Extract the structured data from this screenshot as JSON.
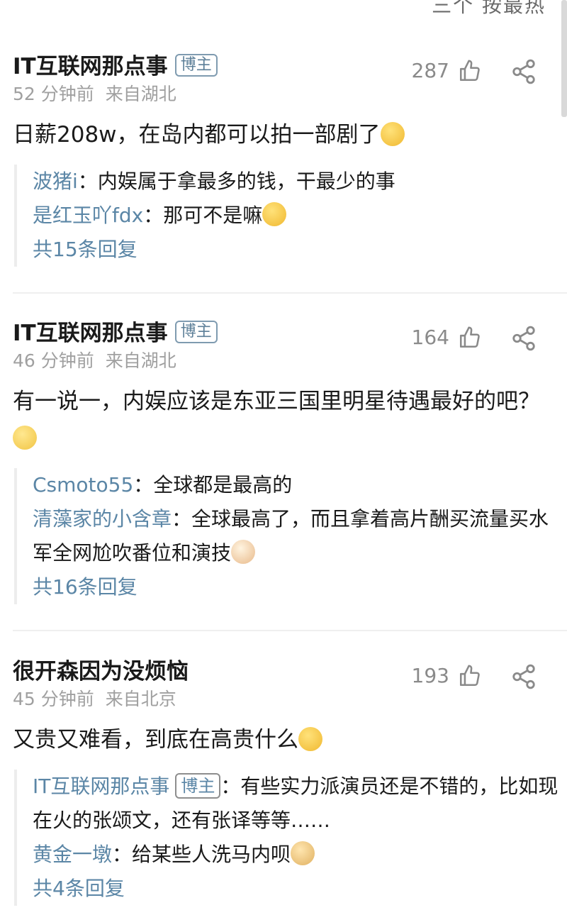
{
  "top_tabs": "三个 按最热",
  "comments": [
    {
      "username": "IT互联网那点事",
      "badge": "博主",
      "time": "52 分钟前",
      "location": "来自湖北",
      "likes": "287",
      "text": "日薪208w，在岛内都可以拍一部剧了",
      "emoji": "cry-laugh",
      "replies": [
        {
          "name": "波猪i",
          "text": "：内娱属于拿最多的钱，干最少的事"
        },
        {
          "name": "是红玉吖fdx",
          "text": "：那可不是嘛",
          "emoji": "laugh"
        }
      ],
      "more": "共15条回复"
    },
    {
      "username": "IT互联网那点事",
      "badge": "博主",
      "time": "46 分钟前",
      "location": "来自湖北",
      "likes": "164",
      "text": "有一说一，内娱应该是东亚三国里明星待遇最好的吧？",
      "emoji": "thinking",
      "replies": [
        {
          "name": "Csmoto55",
          "text": "：全球都是最高的"
        },
        {
          "name": "清藻家的小含章",
          "text": "：全球最高了，而且拿着高片酬买流量买水军全网尬吹番位和演技",
          "emoji": "cat"
        }
      ],
      "more": "共16条回复"
    },
    {
      "username": "很开森因为没烦恼",
      "time": "45 分钟前",
      "location": "来自北京",
      "likes": "193",
      "text": "又贵又难看，到底在高贵什么",
      "emoji": "shush",
      "replies": [
        {
          "name": "IT互联网那点事",
          "badge": "博主",
          "text": "：有些实力派演员还是不错的，比如现在火的张颂文，还有张译等等……"
        },
        {
          "name": "黄金一墩",
          "text": "：给某些人洗马内呗",
          "emoji": "doge"
        }
      ],
      "more": "共4条回复"
    }
  ],
  "icons": {
    "like": "thumb-up-icon",
    "share": "share-icon"
  },
  "colors": {
    "link": "#5b86a6",
    "meta": "#a0a0a0",
    "badge_border": "#7f9bb0"
  }
}
